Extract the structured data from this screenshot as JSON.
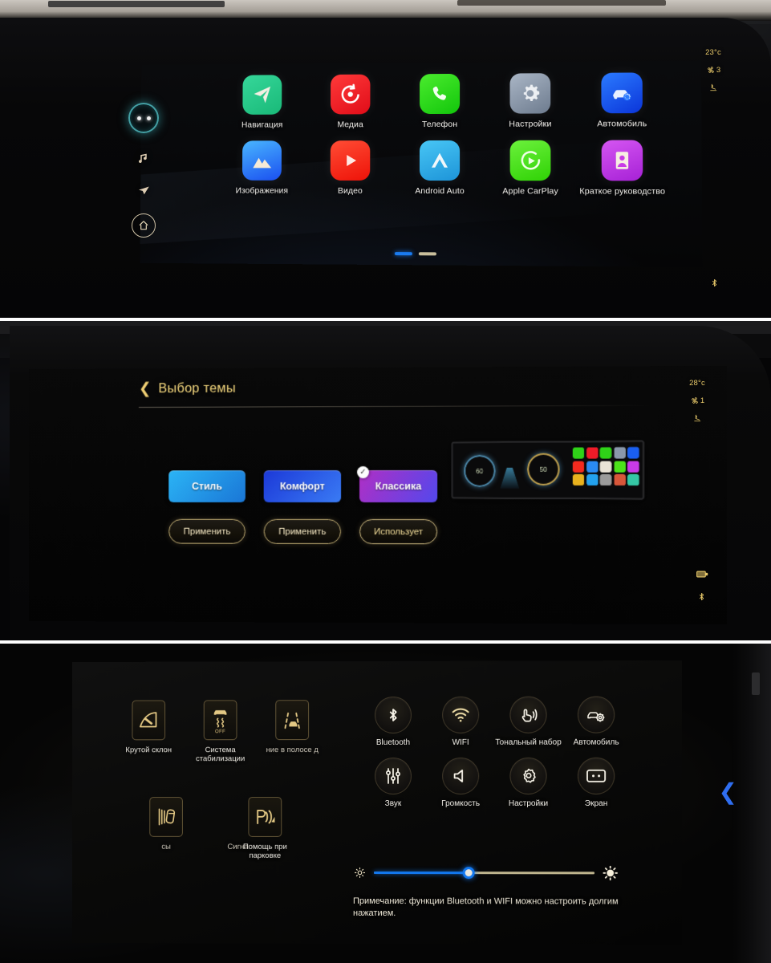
{
  "panel1": {
    "name": "car-infotainment-home-screen",
    "status": {
      "temperature": "23°c",
      "fan_speed": "3",
      "seat_icon": "seat-heating-icon",
      "bluetooth_icon": "bluetooth-audio-icon"
    },
    "rail": [
      {
        "name": "voice-assistant",
        "icon": "voice-assistant-orb-icon"
      },
      {
        "name": "media",
        "icon": "music-note-icon"
      },
      {
        "name": "navigation",
        "icon": "navigation-arrow-icon"
      },
      {
        "name": "home",
        "icon": "home-icon"
      }
    ],
    "apps": [
      {
        "label": "Навигация",
        "icon": "navigation-icon",
        "color": "#2ecb8a"
      },
      {
        "label": "Медиа",
        "icon": "media-icon",
        "color": "#f01b28"
      },
      {
        "label": "Телефон",
        "icon": "phone-icon",
        "color": "#2fd318"
      },
      {
        "label": "Настройки",
        "icon": "settings-gear-icon",
        "color": "#8a98ab"
      },
      {
        "label": "Автомобиль",
        "icon": "car-settings-icon",
        "color": "#1a5ff0"
      },
      {
        "label": "Изображения",
        "icon": "images-icon",
        "color": "#2a8bf2"
      },
      {
        "label": "Видео",
        "icon": "video-play-icon",
        "color": "#f22a1e"
      },
      {
        "label": "Android Auto",
        "icon": "android-auto-icon",
        "color": "#28ade4"
      },
      {
        "label": "Apple CarPlay",
        "icon": "apple-carplay-icon",
        "color": "#4ce31a"
      },
      {
        "label": "Краткое руководство",
        "icon": "quick-guide-icon",
        "color": "#c93be6"
      }
    ],
    "page_indicator": {
      "total": 2,
      "active": 1
    }
  },
  "panel2": {
    "name": "theme-selection-screen",
    "title": "Выбор темы",
    "back_icon": "chevron-left-icon",
    "status": {
      "temperature": "28°c",
      "fan_speed": "1",
      "seat_icon": "seat-heating-icon",
      "battery_icon": "battery-icon",
      "bluetooth_icon": "bluetooth-icon"
    },
    "themes": [
      {
        "label": "Стиль",
        "selected": false,
        "button": "Применить",
        "c1": "#23a2ef",
        "c2": "#1b78d8"
      },
      {
        "label": "Комфорт",
        "selected": false,
        "button": "Применить",
        "c1": "#1c39d8",
        "c2": "#2f6ef2"
      },
      {
        "label": "Классика",
        "selected": true,
        "button": "Использует",
        "c1": "#a92fc0",
        "c2": "#4b46e8"
      }
    ],
    "check_glyph": "✓",
    "preview": {
      "name": "theme-preview-thumbnail",
      "gauge_left": "60",
      "gauge_right": "50"
    },
    "annotation": {
      "name": "green-arrow-annotation",
      "color": "#19d06a"
    }
  },
  "panel3": {
    "name": "quick-settings-screen",
    "vehicle_functions": [
      {
        "label": "Крутой склон",
        "icon": "hill-descent-icon"
      },
      {
        "label": "Система стабилизации",
        "icon": "stability-control-off-icon",
        "badge": "OFF"
      },
      {
        "label": "ние в полосе д",
        "icon": "lane-keeping-icon"
      },
      {
        "label": "сы",
        "icon": "blind-spot-icon"
      },
      {
        "label": "Сигна",
        "icon": "lane-departure-warning-icon"
      },
      {
        "label": "Помощь при парковке",
        "icon": "parking-assist-icon"
      }
    ],
    "quick_toggles": [
      {
        "label": "Bluetooth",
        "icon": "bluetooth-icon"
      },
      {
        "label": "WIFI",
        "icon": "wifi-icon"
      },
      {
        "label": "Тональный набор",
        "icon": "touch-tone-icon"
      },
      {
        "label": "Автомобиль",
        "icon": "car-settings-icon"
      },
      {
        "label": "Звук",
        "icon": "equalizer-icon"
      },
      {
        "label": "Громкость",
        "icon": "volume-icon"
      },
      {
        "label": "Настройки",
        "icon": "settings-gear-icon"
      },
      {
        "label": "Экран",
        "icon": "screen-icon"
      }
    ],
    "brightness": {
      "name": "brightness-slider",
      "value": 43,
      "low_icon": "brightness-low-icon",
      "high_icon": "brightness-high-icon"
    },
    "note": "Примечание: функции Bluetooth и WIFI можно настроить долгим нажатием.",
    "collapse_icon": "chevron-left-icon"
  }
}
